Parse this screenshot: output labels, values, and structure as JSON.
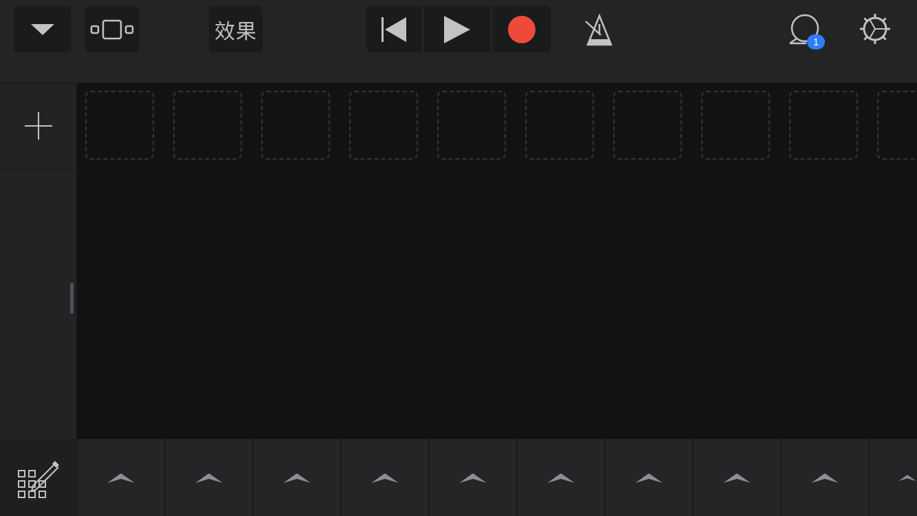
{
  "toolbar": {
    "effects_label": "效果",
    "notification_count": "1"
  },
  "colors": {
    "record": "#ee4a3c",
    "badge": "#2f7cf6",
    "icon": "#c2c3c5"
  },
  "icons": [
    "chevron-down-icon",
    "view-toggle-icon",
    "rewind-icon",
    "play-icon",
    "record-icon",
    "metronome-icon",
    "loop-browser-icon",
    "settings-icon",
    "plus-icon",
    "grid-edit-icon",
    "chevron-up-icon"
  ],
  "grid": {
    "cell_count": 10,
    "column_trigger_count": 10
  }
}
